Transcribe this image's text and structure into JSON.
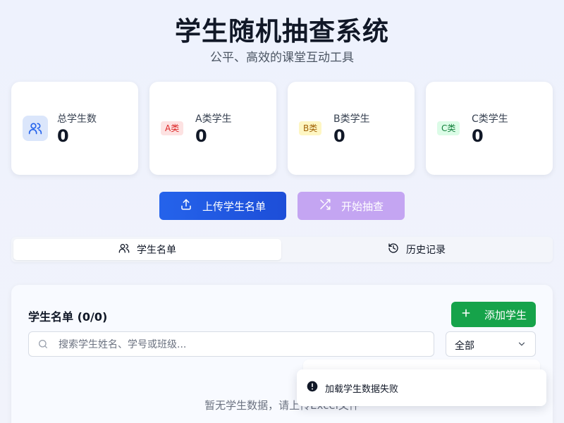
{
  "header": {
    "title": "学生随机抽查系统",
    "subtitle": "公平、高效的课堂互动工具"
  },
  "stats": [
    {
      "label": "总学生数",
      "value": "0",
      "icon": "users-icon"
    },
    {
      "label": "A类学生",
      "value": "0",
      "badge": "A类",
      "badge_color": "#dc2626"
    },
    {
      "label": "B类学生",
      "value": "0",
      "badge": "B类",
      "badge_color": "#a16207"
    },
    {
      "label": "C类学生",
      "value": "0",
      "badge": "C类",
      "badge_color": "#15803d"
    }
  ],
  "actions": {
    "upload_label": "上传学生名单",
    "upload_icon": "upload-icon",
    "draw_label": "开始抽查",
    "draw_icon": "shuffle-icon"
  },
  "tabs": [
    {
      "label": "学生名单",
      "icon": "users-icon",
      "active": true
    },
    {
      "label": "历史记录",
      "icon": "history-icon",
      "active": false
    }
  ],
  "panel": {
    "title": "学生名单 (0/0)",
    "add_label": "添加学生",
    "search_placeholder": "搜索学生姓名、学号或班级...",
    "filter_value": "全部",
    "empty_text": "暂无学生数据，请上传Excel文件"
  },
  "toast": {
    "message": "加载学生数据失败",
    "icon": "alert-circle-icon"
  },
  "colors": {
    "primary": "#1d4ed8",
    "draw_button": "#c4a5f2",
    "success": "#16a34a"
  }
}
